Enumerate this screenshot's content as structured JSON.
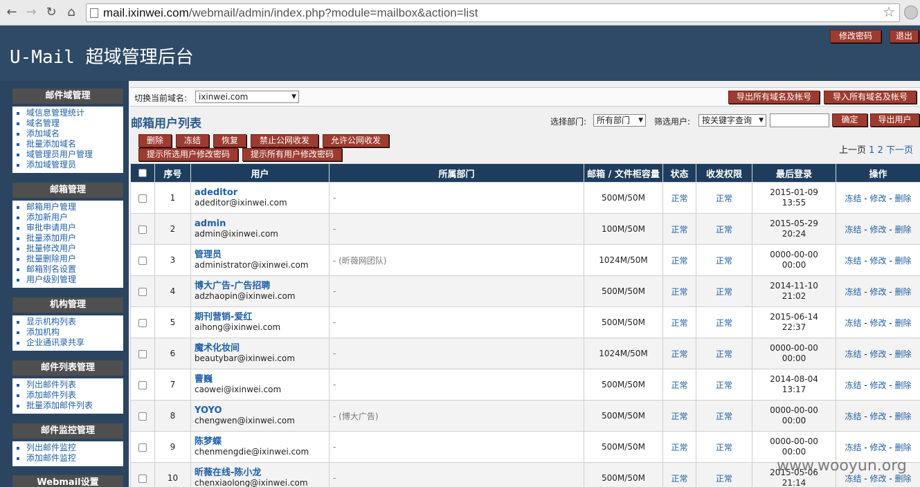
{
  "browser": {
    "url_host": "mail.ixinwei.com",
    "url_path": "/webmail/admin/index.php?module=mailbox&action=list"
  },
  "header": {
    "brand": "U-Mail 超域管理后台",
    "change_password": "修改密码",
    "logout": "退出"
  },
  "sidebar": {
    "groups": [
      {
        "title": "邮件域管理",
        "items": [
          "域信息管理统计",
          "域名管理",
          "添加域名",
          "批量添加域名",
          "域管理员用户管理",
          "添加域管理员"
        ]
      },
      {
        "title": "邮箱管理",
        "items": [
          "邮箱用户管理",
          "添加新用户",
          "审批申请用户",
          "批量添加用户",
          "批量修改用户",
          "批量删除用户",
          "邮箱别名设置",
          "用户级别管理"
        ]
      },
      {
        "title": "机构管理",
        "items": [
          "显示机构列表",
          "添加机构",
          "企业通讯录共享"
        ]
      },
      {
        "title": "邮件列表管理",
        "items": [
          "列出邮件列表",
          "添加邮件列表",
          "批量添加邮件列表"
        ]
      },
      {
        "title": "邮件监控管理",
        "items": [
          "列出邮件监控",
          "添加邮件监控"
        ]
      },
      {
        "title": "Webmail设置",
        "items": []
      }
    ]
  },
  "domainbar": {
    "label": "切换当前域名:",
    "domain": "ixinwei.com",
    "export_all": "导出所有域名及帐号",
    "import_all": "导入所有域名及帐号"
  },
  "list": {
    "title": "邮箱用户列表",
    "dept_label": "选择部门:",
    "dept_value": "所有部门",
    "filter_label": "筛选用户:",
    "filter_value": "按关键字查询",
    "confirm": "确定",
    "export_users": "导出用户"
  },
  "actions": [
    "删除",
    "冻结",
    "恢复",
    "禁止公网收发",
    "允许公网收发",
    "提示所选用户修改密码",
    "提示所有用户修改密码"
  ],
  "pager": {
    "prev": "上一页",
    "p1": "1",
    "p2": "2",
    "next": "下一页"
  },
  "table": {
    "headers": [
      "序号",
      "用户",
      "所属部门",
      "邮箱 / 文件柜容量",
      "状态",
      "收发权限",
      "最后登录",
      "操作"
    ],
    "ops": {
      "freeze": "冻结",
      "edit": "修改",
      "delete": "删除",
      "sep": "-"
    },
    "rows": [
      {
        "no": "1",
        "name": "adeditor",
        "email": "adeditor@ixinwei.com",
        "dept": "-",
        "quota": "500M/50M",
        "status": "正常",
        "perm": "正常",
        "date": "2015-01-09",
        "time": "13:55"
      },
      {
        "no": "2",
        "name": "admin",
        "email": "admin@ixinwei.com",
        "dept": "-",
        "quota": "100M/50M",
        "status": "正常",
        "perm": "正常",
        "date": "2015-05-29",
        "time": "20:24"
      },
      {
        "no": "3",
        "name": "管理员",
        "email": "administrator@ixinwei.com",
        "dept": "- (昕薇网团队)",
        "quota": "1024M/50M",
        "status": "正常",
        "perm": "正常",
        "date": "0000-00-00",
        "time": "00:00"
      },
      {
        "no": "4",
        "name": "博大广告-广告招聘",
        "email": "adzhaopin@ixinwei.com",
        "dept": "-",
        "quota": "500M/50M",
        "status": "正常",
        "perm": "正常",
        "date": "2014-11-10",
        "time": "21:02"
      },
      {
        "no": "5",
        "name": "期刊营销-爱红",
        "email": "aihong@ixinwei.com",
        "dept": "-",
        "quota": "500M/50M",
        "status": "正常",
        "perm": "正常",
        "date": "2015-06-14",
        "time": "22:37"
      },
      {
        "no": "6",
        "name": "魔术化妆间",
        "email": "beautybar@ixinwei.com",
        "dept": "-",
        "quota": "1024M/50M",
        "status": "正常",
        "perm": "正常",
        "date": "0000-00-00",
        "time": "00:00"
      },
      {
        "no": "7",
        "name": "曹巍",
        "email": "caowei@ixinwei.com",
        "dept": "-",
        "quota": "500M/50M",
        "status": "正常",
        "perm": "正常",
        "date": "2014-08-04",
        "time": "13:17"
      },
      {
        "no": "8",
        "name": "YOYO",
        "email": "chengwen@ixinwei.com",
        "dept": "- (博大广告)",
        "quota": "500M/50M",
        "status": "正常",
        "perm": "正常",
        "date": "0000-00-00",
        "time": "00:00"
      },
      {
        "no": "9",
        "name": "陈梦蝶",
        "email": "chenmengdie@ixinwei.com",
        "dept": "-",
        "quota": "500M/50M",
        "status": "正常",
        "perm": "正常",
        "date": "0000-00-00",
        "time": "00:00"
      },
      {
        "no": "10",
        "name": "昕薇在线-陈小龙",
        "email": "chenxiaolong@ixinwei.com",
        "dept": "-",
        "quota": "500M/50M",
        "status": "正常",
        "perm": "正常",
        "date": "2015-05-06",
        "time": "21:14"
      }
    ]
  },
  "watermark": "www.wooyun.org"
}
